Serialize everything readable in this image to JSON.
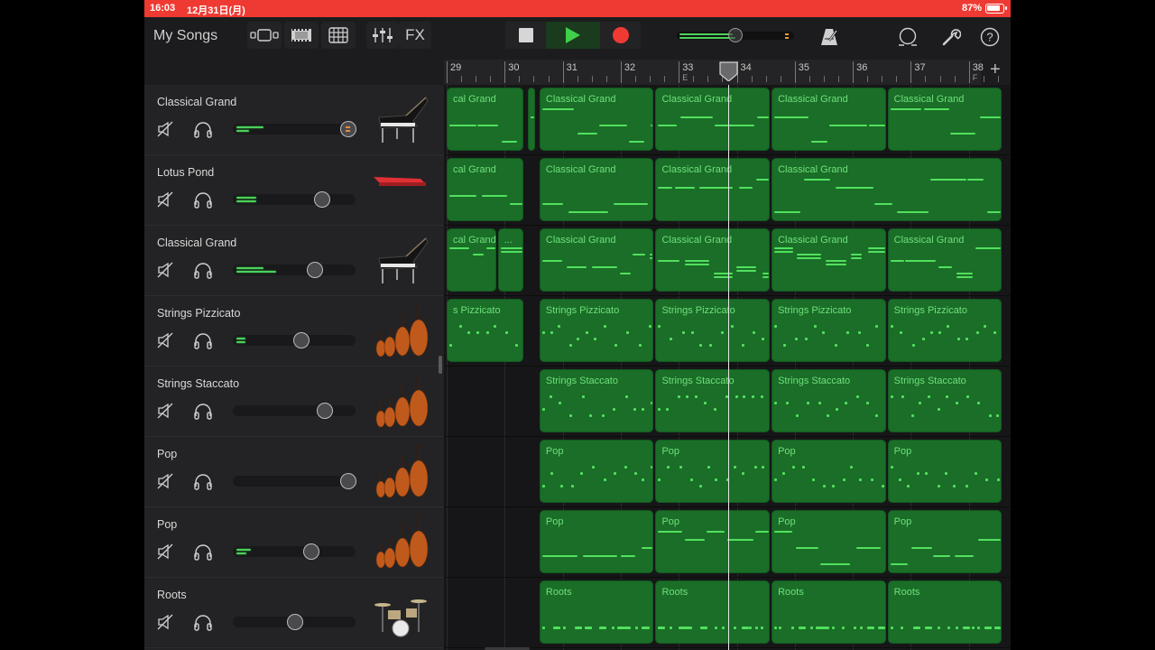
{
  "status_bar": {
    "time": "16:03",
    "date": "12月31日(月)",
    "battery_percent": "87%",
    "battery_level": 0.87,
    "color": "#ee3a32"
  },
  "toolbar": {
    "my_songs_label": "My Songs",
    "fx_label": "FX",
    "view_buttons": [
      "browser-icon",
      "tracks-view-icon",
      "grid-view-icon"
    ],
    "mixer_icon": "mixer-sliders-icon",
    "transport": {
      "stop_icon": "stop-icon",
      "play_icon": "play-icon",
      "record_icon": "record-icon"
    },
    "master_volume": {
      "value": 0.45,
      "meter_levels": [
        0.45,
        0.48
      ]
    },
    "right_icons": [
      "metronome-icon",
      "loop-icon",
      "wrench-icon",
      "help-icon"
    ]
  },
  "ruler": {
    "bars": [
      "29",
      "30",
      "31",
      "32",
      "33",
      "34",
      "35",
      "36",
      "37",
      "38"
    ],
    "markers": [
      {
        "bar": "33",
        "letter": "E"
      },
      {
        "bar": "38",
        "letter": "F"
      }
    ],
    "playhead_bar": 33.85,
    "add_section_label": "+"
  },
  "tracks": [
    {
      "name": "Classical Grand",
      "instrument": "grand-piano",
      "volume": 0.94,
      "meter": [
        0.22,
        0.1
      ],
      "peaking": true
    },
    {
      "name": "Lotus Pond",
      "instrument": "red-keyboard",
      "volume": 0.73,
      "meter": [
        0.16,
        0.16
      ],
      "peaking": false
    },
    {
      "name": "Classical Grand",
      "instrument": "grand-piano",
      "volume": 0.67,
      "meter": [
        0.22,
        0.32
      ],
      "peaking": false
    },
    {
      "name": "Strings Pizzicato",
      "instrument": "strings",
      "volume": 0.56,
      "meter": [
        0.07,
        0.07
      ],
      "peaking": false
    },
    {
      "name": "Strings Staccato",
      "instrument": "strings",
      "volume": 0.75,
      "meter": [],
      "peaking": false
    },
    {
      "name": "Pop",
      "instrument": "strings",
      "volume": 0.94,
      "meter": [],
      "peaking": false
    },
    {
      "name": "Pop",
      "instrument": "strings",
      "volume": 0.64,
      "meter": [
        0.12,
        0.08
      ],
      "peaking": false
    },
    {
      "name": "Roots",
      "instrument": "drum-kit",
      "volume": 0.51,
      "meter": [],
      "peaking": false
    }
  ],
  "regions": [
    [
      {
        "label": "cal Grand",
        "from": 29,
        "to": 30.35
      },
      {
        "label": "",
        "from": 30.4,
        "to": 30.55
      },
      {
        "label": "Classical Grand",
        "from": 30.6,
        "to": 32.6
      },
      {
        "label": "Classical Grand",
        "from": 32.6,
        "to": 34.6
      },
      {
        "label": "Classical Grand",
        "from": 34.6,
        "to": 36.6
      },
      {
        "label": "Classical Grand",
        "from": 36.6,
        "to": 38.6
      }
    ],
    [
      {
        "label": "cal Grand",
        "from": 29,
        "to": 30.35
      },
      {
        "label": "Classical Grand",
        "from": 30.6,
        "to": 32.6
      },
      {
        "label": "Classical Grand",
        "from": 32.6,
        "to": 34.6
      },
      {
        "label": "Classical Grand",
        "from": 34.6,
        "to": 38.6
      }
    ],
    [
      {
        "label": "cal Grand",
        "from": 29,
        "to": 29.88
      },
      {
        "label": "...",
        "from": 29.88,
        "to": 30.35
      },
      {
        "label": "Classical Grand",
        "from": 30.6,
        "to": 32.6
      },
      {
        "label": "Classical Grand",
        "from": 32.6,
        "to": 34.6
      },
      {
        "label": "Classical Grand",
        "from": 34.6,
        "to": 36.6
      },
      {
        "label": "Classical Grand",
        "from": 36.6,
        "to": 38.6
      }
    ],
    [
      {
        "label": "s Pizzicato",
        "from": 29,
        "to": 30.35
      },
      {
        "label": "Strings Pizzicato",
        "from": 30.6,
        "to": 32.6
      },
      {
        "label": "Strings Pizzicato",
        "from": 32.6,
        "to": 34.6
      },
      {
        "label": "Strings Pizzicato",
        "from": 34.6,
        "to": 36.6
      },
      {
        "label": "Strings Pizzicato",
        "from": 36.6,
        "to": 38.6
      }
    ],
    [
      {
        "label": "Strings Staccato",
        "from": 30.6,
        "to": 32.6
      },
      {
        "label": "Strings Staccato",
        "from": 32.6,
        "to": 34.6
      },
      {
        "label": "Strings Staccato",
        "from": 34.6,
        "to": 36.6
      },
      {
        "label": "Strings Staccato",
        "from": 36.6,
        "to": 38.6
      }
    ],
    [
      {
        "label": "Pop",
        "from": 30.6,
        "to": 32.6
      },
      {
        "label": "Pop",
        "from": 32.6,
        "to": 34.6
      },
      {
        "label": "Pop",
        "from": 34.6,
        "to": 36.6
      },
      {
        "label": "Pop",
        "from": 36.6,
        "to": 38.6
      }
    ],
    [
      {
        "label": "Pop",
        "from": 30.6,
        "to": 32.6
      },
      {
        "label": "Pop",
        "from": 32.6,
        "to": 34.6
      },
      {
        "label": "Pop",
        "from": 34.6,
        "to": 36.6
      },
      {
        "label": "Pop",
        "from": 36.6,
        "to": 38.6
      }
    ],
    [
      {
        "label": "Roots",
        "from": 30.6,
        "to": 32.6
      },
      {
        "label": "Roots",
        "from": 32.6,
        "to": 34.6
      },
      {
        "label": "Roots",
        "from": 34.6,
        "to": 36.6
      },
      {
        "label": "Roots",
        "from": 36.6,
        "to": 38.6
      }
    ]
  ],
  "note_styles": [
    "legato",
    "legato",
    "chords",
    "dots",
    "dots",
    "dots",
    "legato",
    "drums"
  ],
  "colors": {
    "region": "#1a6e28",
    "note": "#52e05e",
    "region_label": "#6fe07a",
    "record": "#ef3a33",
    "play": "#3fcf4a"
  }
}
